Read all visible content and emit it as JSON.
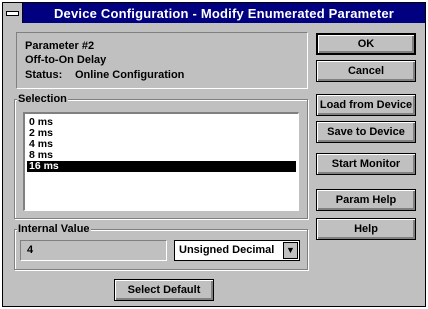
{
  "window": {
    "title": "Device Configuration - Modify Enumerated Parameter"
  },
  "info": {
    "parameter": "Parameter #2",
    "name": "Off-to-On Delay",
    "status_label": "Status:",
    "status_value": "Online Configuration"
  },
  "selection": {
    "label": "Selection",
    "items": [
      "0 ms",
      "2 ms",
      "4 ms",
      "8 ms",
      "16 ms"
    ],
    "selected_index": 4
  },
  "internal_value": {
    "label": "Internal Value",
    "value": "4",
    "format": "Unsigned Decimal"
  },
  "buttons": {
    "ok": "OK",
    "cancel": "Cancel",
    "load": "Load from Device",
    "save": "Save to Device",
    "monitor": "Start Monitor",
    "param_help": "Param Help",
    "help": "Help",
    "select_default": "Select Default"
  },
  "colors": {
    "titlebar": "#000080",
    "face": "#c0c0c0",
    "selection": "#000000"
  }
}
